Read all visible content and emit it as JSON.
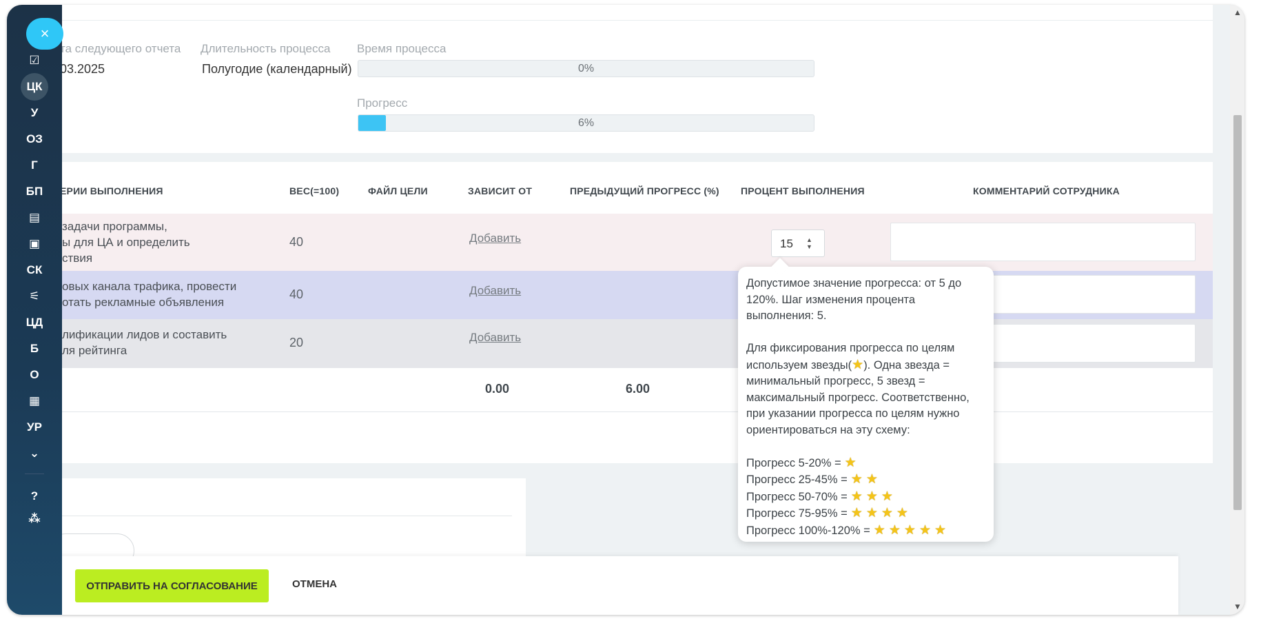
{
  "sidebar": {
    "close_glyph": "×",
    "items": [
      {
        "label": "☑",
        "icon": "checklist-icon"
      },
      {
        "label": "ЦК"
      },
      {
        "label": "У"
      },
      {
        "label": "ОЗ"
      },
      {
        "label": "Г"
      },
      {
        "label": "БП"
      },
      {
        "label": "▤",
        "icon": "calendar-icon"
      },
      {
        "label": "▣",
        "icon": "id-card-icon"
      },
      {
        "label": "СК"
      },
      {
        "label": "⚟",
        "icon": "sliders-icon"
      },
      {
        "label": "ЦД"
      },
      {
        "label": "Б"
      },
      {
        "label": "О"
      },
      {
        "label": "▦",
        "icon": "schedule-icon"
      },
      {
        "label": "УР"
      },
      {
        "label": "⌄",
        "icon": "chevron-down-circle-icon"
      },
      {
        "label": "?",
        "icon": "help-icon"
      },
      {
        "label": "⁂",
        "icon": "structure-icon"
      }
    ]
  },
  "info": {
    "next_report_label": "та следующего отчета",
    "next_report_value": "03.2025",
    "duration_label": "Длительность процесса",
    "duration_value": "Полугодие (календарный)",
    "time_label": "Время процесса",
    "time_value": "0%",
    "time_fraction": 0.0,
    "progress_label": "Прогресс",
    "progress_value": "6%",
    "progress_fraction": 0.06
  },
  "table": {
    "headers": {
      "criteria": "ЕРИИ ВЫПОЛНЕНИЯ",
      "weight": "ВЕС(=100)",
      "file": "ФАЙЛ ЦЕЛИ",
      "depends": "ЗАВИСИТ ОТ",
      "prev_progress": "ПРЕДЫДУЩИЙ ПРОГРЕСС (%)",
      "percent": "ПРОЦЕНТ ВЫПОЛНЕНИЯ",
      "comment": "КОММЕНТАРИЙ СОТРУДНИКА"
    },
    "rows": [
      {
        "line1": "задачи программы,",
        "line2": "ы для ЦА и определить",
        "line3": "ствия",
        "weight": "40",
        "add": "Добавить",
        "percent": "15",
        "color": "#f7eef0"
      },
      {
        "line1": "овых канала трафика, провести",
        "line2": "отать рекламные объявления",
        "weight": "40",
        "add": "Добавить",
        "color": "#d6d9f2"
      },
      {
        "line1": "лификации лидов и составить",
        "line2": "ля рейтинга",
        "weight": "20",
        "add": "Добавить",
        "color": "#e5e6ea"
      }
    ],
    "totals": {
      "depends": "0.00",
      "prev_progress": "6.00"
    }
  },
  "tooltip": {
    "p1a": "Допустимое значение прогресса: от 5 до",
    "p1b": "120%. Шаг изменения процента",
    "p1c": "выполнения: 5.",
    "p2a": "Для фиксирования прогресса по целям",
    "p2b_pre": "используем звезды(",
    "p2b_post": "). Одна звезда =",
    "p2c": "минимальный прогресс, 5 звезд =",
    "p2d": "максимальный прогресс. Соответственно,",
    "p2e": "при указании прогресса по целям нужно",
    "p2f": "ориентироваться на эту схему:",
    "scale": [
      {
        "text": "Прогресс 5-20% =",
        "stars": 1
      },
      {
        "text": "Прогресс 25-45% =",
        "stars": 2
      },
      {
        "text": "Прогресс 50-70% =",
        "stars": 3
      },
      {
        "text": "Прогресс 75-95% =",
        "stars": 4
      },
      {
        "text": "Прогресс 100%-120% =",
        "stars": 5
      }
    ],
    "star_glyph": "★"
  },
  "footer": {
    "submit_label": "ОТПРАВИТЬ НА СОГЛАСОВАНИЕ",
    "cancel_label": "ОТМЕНА"
  },
  "colors": {
    "accent": "#2fc7f7",
    "submit": "#bbed21",
    "sidebar": "#1c3247"
  }
}
